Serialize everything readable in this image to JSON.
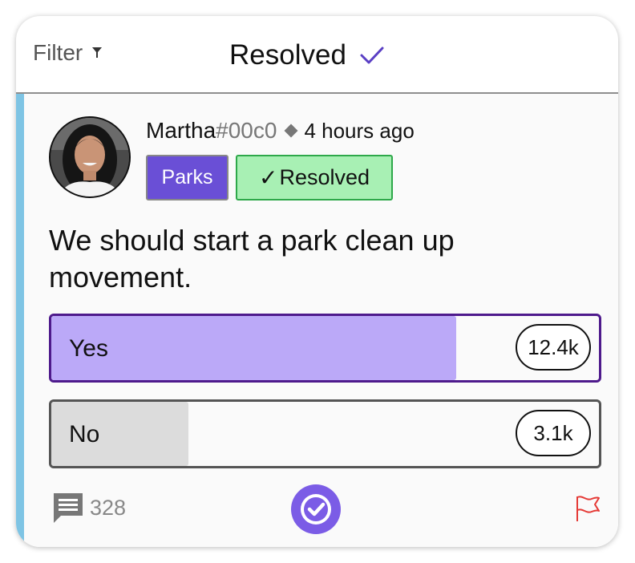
{
  "header": {
    "filter_label": "Filter",
    "title": "Resolved",
    "check_color": "#5a3fc4"
  },
  "post": {
    "author": "Martha",
    "author_tag": "#00c0",
    "time": "4 hours ago",
    "tags": [
      "Parks",
      "Resolved"
    ],
    "question": "We should start a park clean up movement.",
    "accent_color": "#7ec4e4"
  },
  "poll": {
    "options": [
      {
        "label": "Yes",
        "count": "12.4k",
        "fill_percent": 74,
        "color": "#bba9f8",
        "selected": true
      },
      {
        "label": "No",
        "count": "3.1k",
        "fill_percent": 25,
        "color": "#dcdcdc",
        "selected": false
      }
    ]
  },
  "footer": {
    "comment_count": "328",
    "comment_icon": "comment-icon",
    "resolve_icon": "check-circle-icon",
    "flag_icon": "flag-icon",
    "flag_color": "#e53935"
  }
}
